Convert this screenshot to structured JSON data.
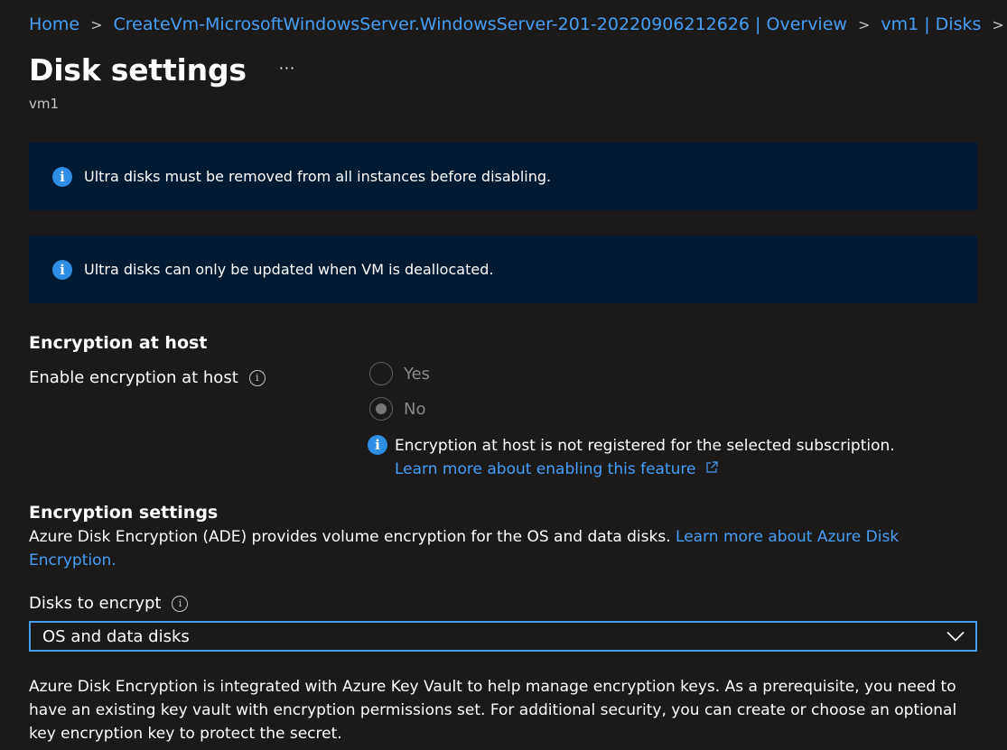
{
  "breadcrumb": {
    "items": [
      "Home",
      "CreateVm-MicrosoftWindowsServer.WindowsServer-201-20220906212626 | Overview",
      "vm1 | Disks"
    ],
    "separator": ">"
  },
  "header": {
    "title": "Disk settings",
    "more": "···",
    "subtitle": "vm1"
  },
  "banners": [
    {
      "text": "Ultra disks must be removed from all instances before disabling."
    },
    {
      "text": "Ultra disks can only be updated when VM is deallocated."
    }
  ],
  "encryption_at_host": {
    "heading": "Encryption at host",
    "label": "Enable encryption at host",
    "options": [
      "Yes",
      "No"
    ],
    "selected": "No",
    "disabled": true,
    "note": "Encryption at host is not registered for the selected subscription.",
    "link": "Learn more about enabling this feature"
  },
  "encryption_settings": {
    "heading": "Encryption settings",
    "description": "Azure Disk Encryption (ADE) provides volume encryption for the OS and data disks. ",
    "link": "Learn more about Azure Disk Encryption.",
    "disks_label": "Disks to encrypt",
    "disks_value": "OS and data disks",
    "key_vault_text": "Azure Disk Encryption is integrated with Azure Key Vault to help manage encryption keys. As a prerequisite, you need to have an existing key vault with encryption permissions set. For additional security, you can create or choose an optional key encryption key to protect the secret."
  },
  "icons": {
    "info": "info-icon",
    "tooltip": "info-outline-icon",
    "external": "external-link-icon",
    "chevron": "chevron-down-icon"
  },
  "colors": {
    "background": "#1b1a19",
    "banner": "#001a33",
    "link": "#479ef5",
    "info_icon": "#2f8de4"
  }
}
